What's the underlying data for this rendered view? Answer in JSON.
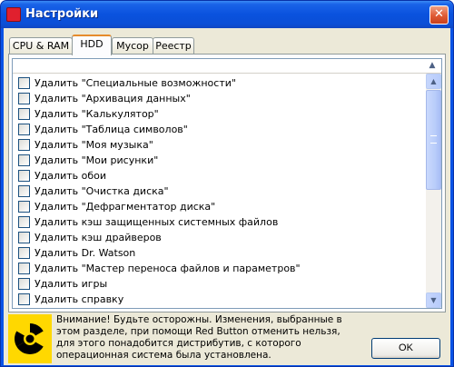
{
  "window": {
    "title": "Настройки",
    "close_glyph": "✕"
  },
  "tabs": [
    {
      "label": "CPU & RAM",
      "active": false
    },
    {
      "label": "HDD",
      "active": true
    },
    {
      "label": "Мусор",
      "active": false
    },
    {
      "label": "Реестр",
      "active": false
    }
  ],
  "list": {
    "items": [
      {
        "label": "Удалить \"Специальные возможности\"",
        "checked": false
      },
      {
        "label": "Удалить \"Архивация данных\"",
        "checked": false
      },
      {
        "label": "Удалить \"Калькулятор\"",
        "checked": false
      },
      {
        "label": "Удалить \"Таблица символов\"",
        "checked": false
      },
      {
        "label": "Удалить \"Моя музыка\"",
        "checked": false
      },
      {
        "label": "Удалить \"Мои рисунки\"",
        "checked": false
      },
      {
        "label": "Удалить обои",
        "checked": false
      },
      {
        "label": "Удалить \"Очистка диска\"",
        "checked": false
      },
      {
        "label": "Удалить \"Дефрагментатор диска\"",
        "checked": false
      },
      {
        "label": "Удалить кэш защищенных системных файлов",
        "checked": false
      },
      {
        "label": "Удалить кэш драйверов",
        "checked": false
      },
      {
        "label": "Удалить Dr. Watson",
        "checked": false
      },
      {
        "label": "Удалить \"Мастер переноса файлов и параметров\"",
        "checked": false
      },
      {
        "label": "Удалить игры",
        "checked": false
      },
      {
        "label": "Удалить справку",
        "checked": false
      }
    ],
    "scroll_up_glyph": "▲",
    "scroll_down_glyph": "▼",
    "header_scroll_glyph": "▲"
  },
  "warning": {
    "text": "Внимание! Будьте осторожны. Изменения, выбранные в этом разделе, при помощи Red Button отменить нельзя, для этого понадобится дистрибутив, с которого операционная система была установлена.",
    "icon": "radiation-icon"
  },
  "ok_button": {
    "label": "OK"
  },
  "colors": {
    "titlebar": "#0a52de",
    "dialog_bg": "#ece9d8",
    "warning_icon_bg": "#ffd800",
    "app_icon": "#e0202e"
  }
}
